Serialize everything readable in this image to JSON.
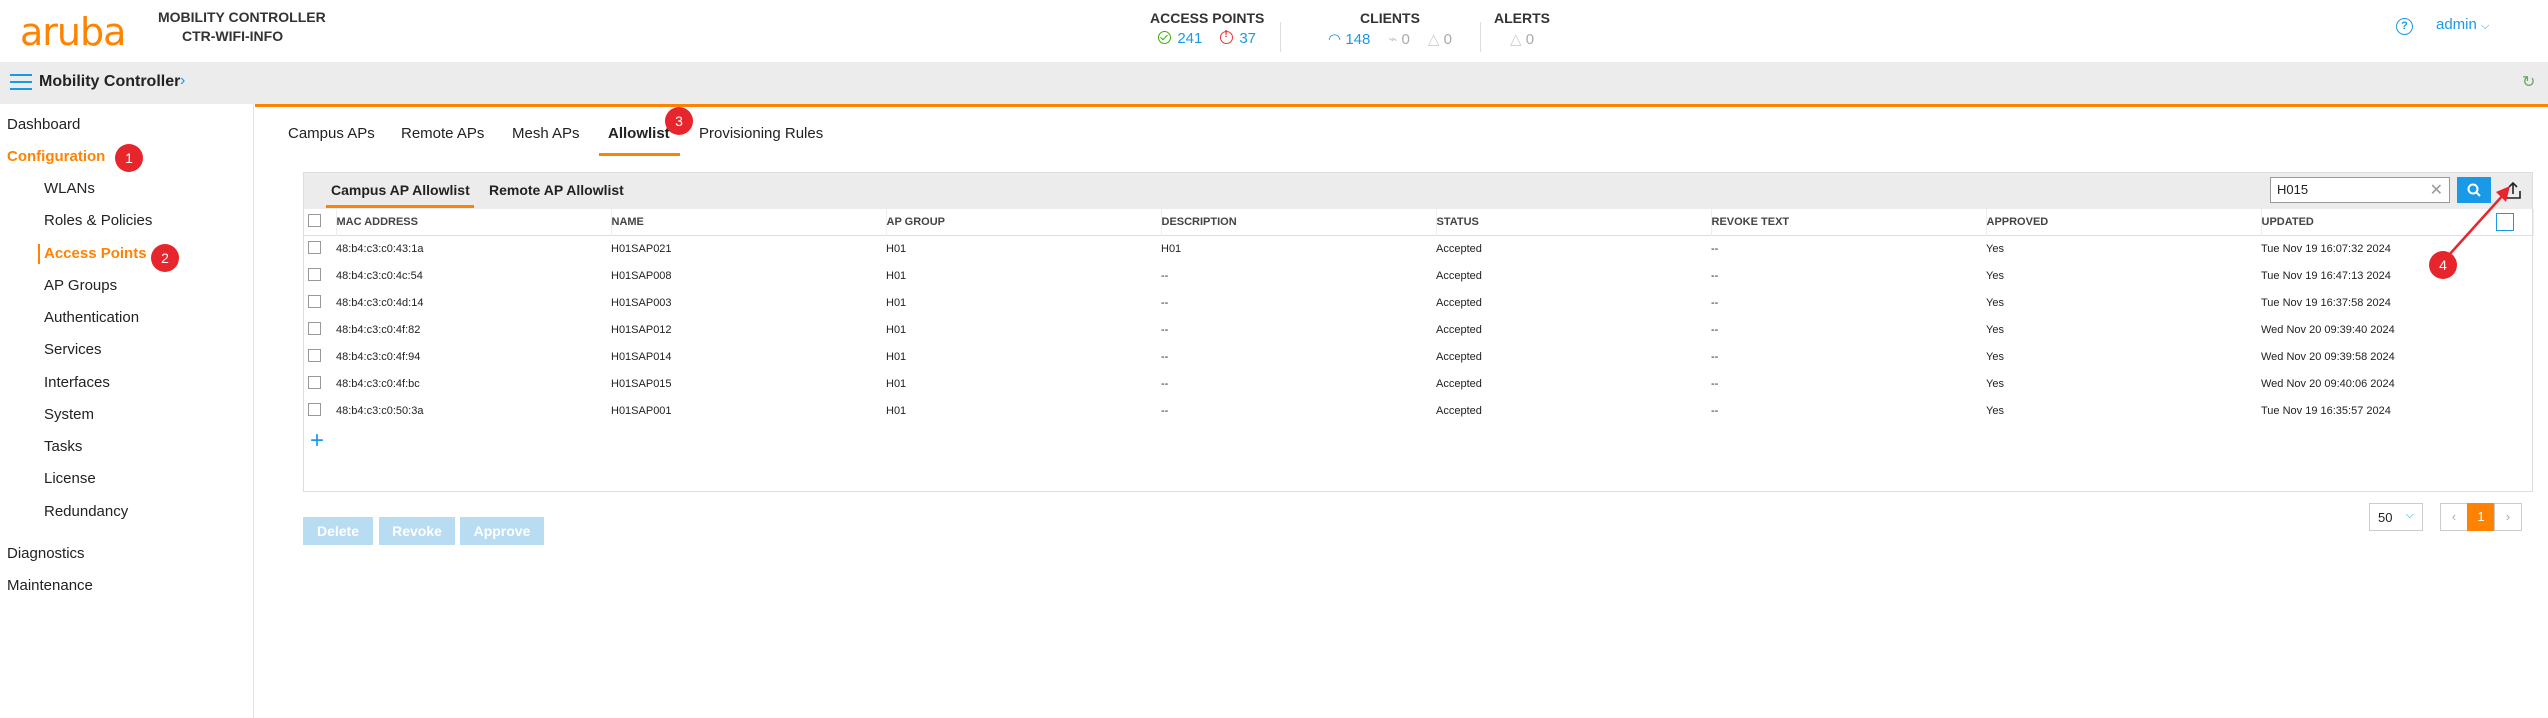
{
  "header": {
    "logo": "aruba",
    "controller_title": "MOBILITY CONTROLLER",
    "controller_name": "CTR-WIFI-INFO",
    "access_points": {
      "label": "ACCESS POINTS",
      "up": "241",
      "down": "37"
    },
    "clients": {
      "label": "CLIENTS",
      "wireless": "148",
      "wired": "0",
      "other": "0"
    },
    "alerts": {
      "label": "ALERTS",
      "count": "0"
    },
    "user": "admin"
  },
  "breadcrumb": {
    "title": "Mobility Controller"
  },
  "sidebar": {
    "items": [
      {
        "label": "Dashboard"
      },
      {
        "label": "Configuration"
      },
      {
        "label": "WLANs"
      },
      {
        "label": "Roles & Policies"
      },
      {
        "label": "Access Points"
      },
      {
        "label": "AP Groups"
      },
      {
        "label": "Authentication"
      },
      {
        "label": "Services"
      },
      {
        "label": "Interfaces"
      },
      {
        "label": "System"
      },
      {
        "label": "Tasks"
      },
      {
        "label": "License"
      },
      {
        "label": "Redundancy"
      },
      {
        "label": "Diagnostics"
      },
      {
        "label": "Maintenance"
      }
    ]
  },
  "annotations": [
    "1",
    "2",
    "3",
    "4"
  ],
  "tabs": [
    "Campus APs",
    "Remote APs",
    "Mesh APs",
    "Allowlist",
    "Provisioning Rules"
  ],
  "subtabs": [
    "Campus AP Allowlist",
    "Remote AP Allowlist"
  ],
  "search": {
    "value": "H015"
  },
  "table": {
    "headers": [
      "MAC ADDRESS",
      "NAME",
      "AP GROUP",
      "DESCRIPTION",
      "STATUS",
      "REVOKE TEXT",
      "APPROVED",
      "UPDATED"
    ],
    "rows": [
      [
        "48:b4:c3:c0:43:1a",
        "H01SAP021",
        "H01",
        "H01",
        "Accepted",
        "--",
        "Yes",
        "Tue Nov 19 16:07:32 2024"
      ],
      [
        "48:b4:c3:c0:4c:54",
        "H01SAP008",
        "H01",
        "--",
        "Accepted",
        "--",
        "Yes",
        "Tue Nov 19 16:47:13 2024"
      ],
      [
        "48:b4:c3:c0:4d:14",
        "H01SAP003",
        "H01",
        "--",
        "Accepted",
        "--",
        "Yes",
        "Tue Nov 19 16:37:58 2024"
      ],
      [
        "48:b4:c3:c0:4f:82",
        "H01SAP012",
        "H01",
        "--",
        "Accepted",
        "--",
        "Yes",
        "Wed Nov 20 09:39:40 2024"
      ],
      [
        "48:b4:c3:c0:4f:94",
        "H01SAP014",
        "H01",
        "--",
        "Accepted",
        "--",
        "Yes",
        "Wed Nov 20 09:39:58 2024"
      ],
      [
        "48:b4:c3:c0:4f:bc",
        "H01SAP015",
        "H01",
        "--",
        "Accepted",
        "--",
        "Yes",
        "Wed Nov 20 09:40:06 2024"
      ],
      [
        "48:b4:c3:c0:50:3a",
        "H01SAP001",
        "H01",
        "--",
        "Accepted",
        "--",
        "Yes",
        "Tue Nov 19 16:35:57 2024"
      ]
    ]
  },
  "actions": [
    "Delete",
    "Revoke",
    "Approve"
  ],
  "pagination": {
    "page_size": "50",
    "current_page": "1"
  },
  "colors": {
    "accent": "#ff8300",
    "link": "#1a9ae6",
    "badge": "#e6262c"
  }
}
